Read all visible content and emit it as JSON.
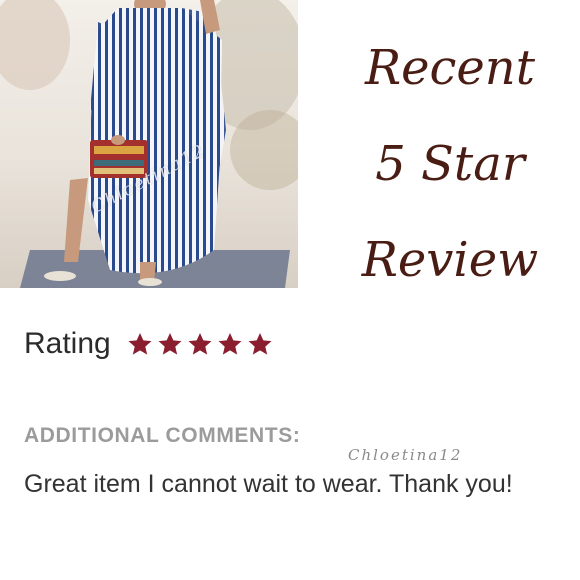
{
  "product_photo": {
    "alt": "Blue and white striped kaftan dress",
    "watermark": "Chloetina12"
  },
  "headline": {
    "line1": "Recent",
    "line2": "5 Star",
    "line3": "Review"
  },
  "rating": {
    "label": "Rating",
    "stars": 5,
    "max_stars": 5,
    "star_icon": "star-icon",
    "star_color": "#8b1e2e"
  },
  "comments": {
    "label": "ADDITIONAL COMMENTS:",
    "watermark": "Chloetina12",
    "text": "Great item I cannot wait to wear. Thank you!"
  },
  "colors": {
    "headline": "#4a1d14",
    "label_gray": "#9b9b9b",
    "text": "#333333"
  }
}
